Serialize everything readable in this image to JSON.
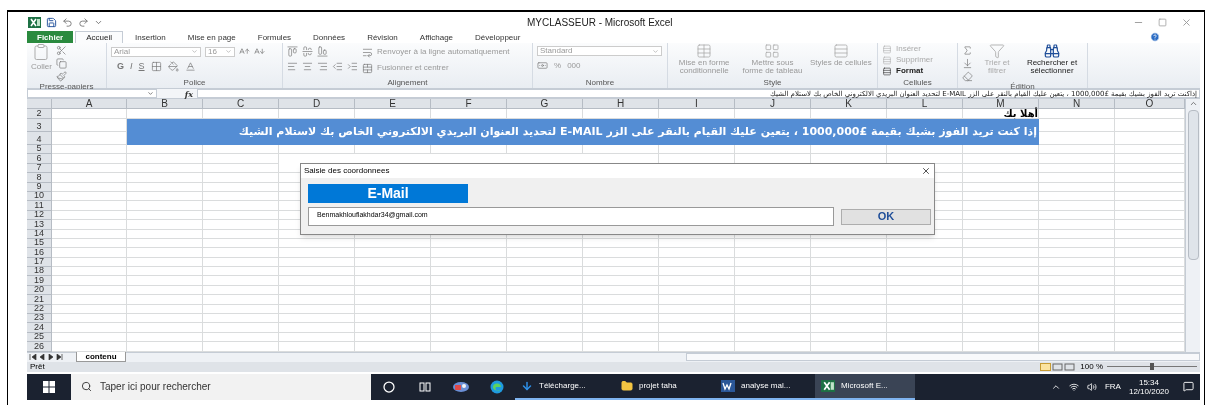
{
  "window": {
    "title": "MYCLASSEUR - Microsoft Excel"
  },
  "ribbon_tabs": [
    {
      "label": "Fichier",
      "kind": "file",
      "selected": false
    },
    {
      "label": "Accueil",
      "kind": "tab",
      "selected": true
    },
    {
      "label": "Insertion",
      "kind": "tab",
      "selected": false
    },
    {
      "label": "Mise en page",
      "kind": "tab",
      "selected": false
    },
    {
      "label": "Formules",
      "kind": "tab",
      "selected": false
    },
    {
      "label": "Données",
      "kind": "tab",
      "selected": false
    },
    {
      "label": "Révision",
      "kind": "tab",
      "selected": false
    },
    {
      "label": "Affichage",
      "kind": "tab",
      "selected": false
    },
    {
      "label": "Développeur",
      "kind": "tab",
      "selected": false
    }
  ],
  "ribbon": {
    "clipboard": {
      "paste": "Coller",
      "label": "Presse-papiers"
    },
    "font": {
      "name": "Arial",
      "size": "16",
      "styles": [
        "G",
        "I",
        "S"
      ],
      "label": "Police"
    },
    "alignment": {
      "wrap": "Renvoyer à la ligne automatiquement",
      "merge": "Fusionner et centrer",
      "label": "Alignement"
    },
    "number": {
      "format": "Standard",
      "percent": "%",
      "thousands": "000",
      "label": "Nombre"
    },
    "styles": {
      "buttons": [
        "Mise en forme conditionnelle",
        "Mettre sous forme de tableau",
        "Styles de cellules"
      ],
      "label": "Style"
    },
    "cells": {
      "buttons": [
        {
          "label": "Insérer",
          "disabled": true
        },
        {
          "label": "Supprimer",
          "disabled": true
        },
        {
          "label": "Format",
          "disabled": false
        }
      ],
      "label": "Cellules"
    },
    "editing": {
      "buttons": [
        {
          "label": "Trier et filtrer",
          "disabled": true
        },
        {
          "label": "Rechercher et sélectionner",
          "disabled": false
        }
      ],
      "label": "Édition"
    }
  },
  "formula_bar": {
    "fx": "fx",
    "value": "إذاكنت تريد الفوز بشيك بقيمة £1000,000 ، يتعين عليك القيام بالنقر على الزر E-MAIL لتحديد العنوان البريدي الالكتروني الخاص بك لاستلام الشيك"
  },
  "sheet": {
    "columns": [
      "A",
      "B",
      "C",
      "D",
      "E",
      "F",
      "G",
      "H",
      "I",
      "J",
      "K",
      "L",
      "M",
      "N",
      "O"
    ],
    "rows": [
      "2",
      "3",
      "4",
      "5",
      "6",
      "7",
      "8",
      "9",
      "10",
      "11",
      "12",
      "13",
      "14",
      "15",
      "16",
      "17",
      "18",
      "19",
      "20",
      "21",
      "22",
      "23",
      "24",
      "25",
      "26"
    ],
    "greeting": "أهلا بك",
    "banner": "إذا كنت تريد الفوز بشيك بقيمة £1000,000 ، يتعين عليك القيام بالنقر على الزر E-MAIL لتحديد العنوان البريدي الالكتروني الخاص بك لاستلام الشيك"
  },
  "dialog": {
    "title": "Saisie des coordonnees",
    "heading": "E-Mail",
    "email": "Benmakhlouflakhdar34@gmail.com",
    "ok": "OK"
  },
  "sheet_tabs": [
    {
      "label": "contenu",
      "selected": true
    }
  ],
  "status_bar": {
    "text": "Prêt",
    "zoom": "100 %",
    "level": 0.5
  },
  "taskbar": {
    "search": "Taper ici pour rechercher",
    "apps": [
      {
        "kind": "cortana",
        "selected": false
      },
      {
        "kind": "taskview",
        "selected": false
      },
      {
        "kind": "app",
        "selected": false
      },
      {
        "kind": "edge",
        "selected": false
      },
      {
        "kind": "downloads",
        "label": "Télécharge...",
        "selected": false
      },
      {
        "kind": "folder",
        "label": "projet taha",
        "selected": false
      },
      {
        "kind": "word",
        "label": "analyse mal...",
        "selected": false
      },
      {
        "kind": "excel",
        "label": "Microsoft E...",
        "selected": true
      }
    ],
    "language": "FRA",
    "time": "15:34",
    "date": "12/10/2020"
  }
}
